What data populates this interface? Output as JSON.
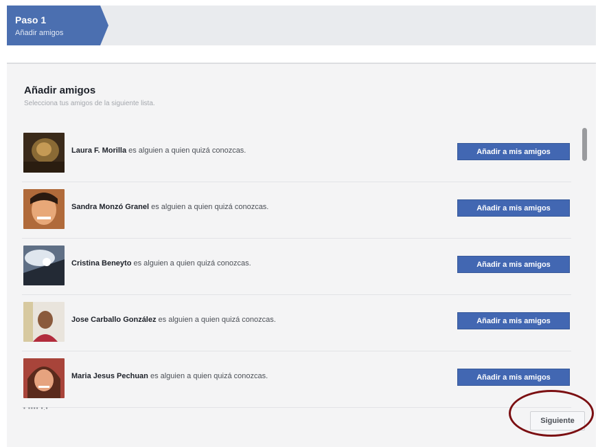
{
  "step": {
    "title": "Paso 1",
    "subtitle": "Añadir amigos"
  },
  "panel": {
    "title": "Añadir amigos",
    "subtitle": "Selecciona tus amigos de la siguiente lista."
  },
  "suggestions": [
    {
      "name": "Laura F. Morilla",
      "text": " es alguien a quien quizá conozcas.",
      "button": "Añadir a mis amigos"
    },
    {
      "name": "Sandra Monzó Granel",
      "text": " es alguien a quien quizá conozcas.",
      "button": "Añadir a mis amigos"
    },
    {
      "name": "Cristina Beneyto",
      "text": " es alguien a quien quizá conozcas.",
      "button": "Añadir a mis amigos"
    },
    {
      "name": "Jose Carballo González",
      "text": " es alguien a quien quizá conozcas.",
      "button": "Añadir a mis amigos"
    },
    {
      "name": "Maria Jesus Pechuan",
      "text": " es alguien a quien quizá conozcas.",
      "button": "Añadir a mis amigos"
    }
  ],
  "next_button": "Siguiente",
  "colors": {
    "brand": "#4267b2",
    "step": "#4b6fb0",
    "highlight": "#7b0f12"
  }
}
